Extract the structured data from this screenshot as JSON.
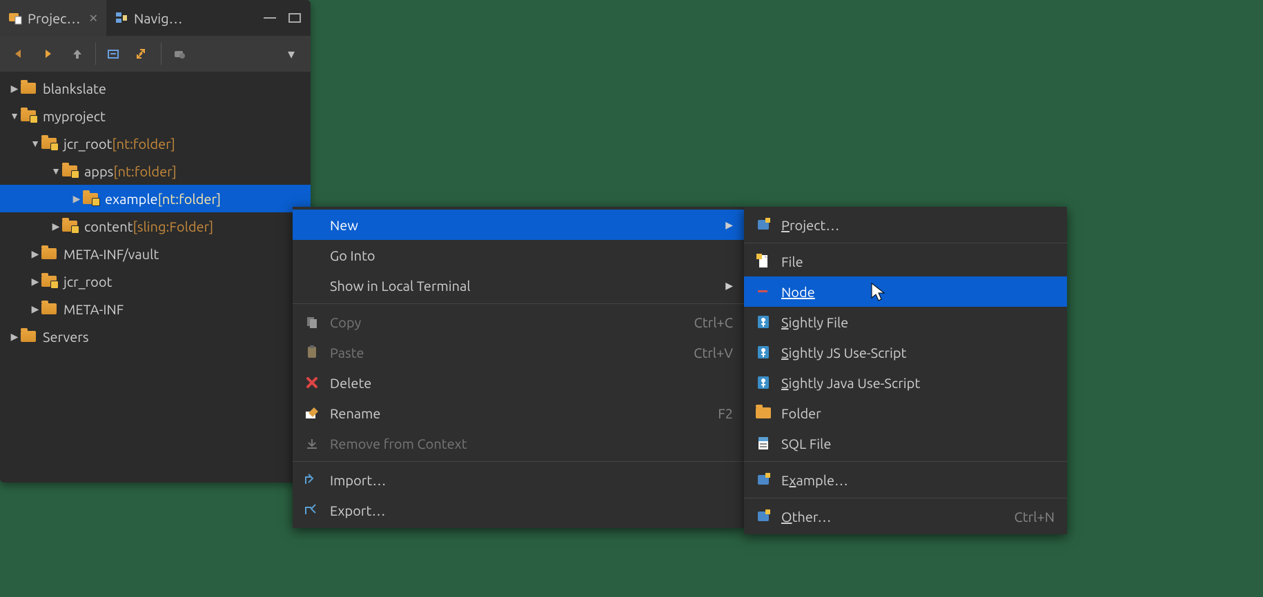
{
  "tabs": {
    "project": "Projec…",
    "navigator": "Navig…"
  },
  "tree": {
    "blankslate": "blankslate",
    "myproject": "myproject",
    "jcr_root": "jcr_root",
    "jcr_root_type": " [nt:folder]",
    "apps": "apps",
    "apps_type": " [nt:folder]",
    "example": "example",
    "example_type": " [nt:folder]",
    "content": "content",
    "content_type": " [sling:Folder]",
    "meta_vault": "META-INF/vault",
    "jcr_root2": "jcr_root",
    "meta_inf": "META-INF",
    "servers": "Servers"
  },
  "menu1": {
    "new": "New",
    "go_into": "Go Into",
    "show_terminal": "Show in Local Terminal",
    "copy": "Copy",
    "copy_accel": "Ctrl+C",
    "paste": "Paste",
    "paste_accel": "Ctrl+V",
    "delete": "Delete",
    "rename": "Rename",
    "rename_accel": "F2",
    "remove_ctx": "Remove from Context",
    "import": "Import…",
    "export": "Export…"
  },
  "menu2": {
    "project": "Project…",
    "file": "File",
    "node": "Node",
    "sightly_file": "Sightly File",
    "sightly_js": "Sightly JS Use-Script",
    "sightly_java": "Sightly Java Use-Script",
    "folder": "Folder",
    "sql": "SQL File",
    "example": "Example…",
    "other": "Other…",
    "other_accel": "Ctrl+N"
  }
}
